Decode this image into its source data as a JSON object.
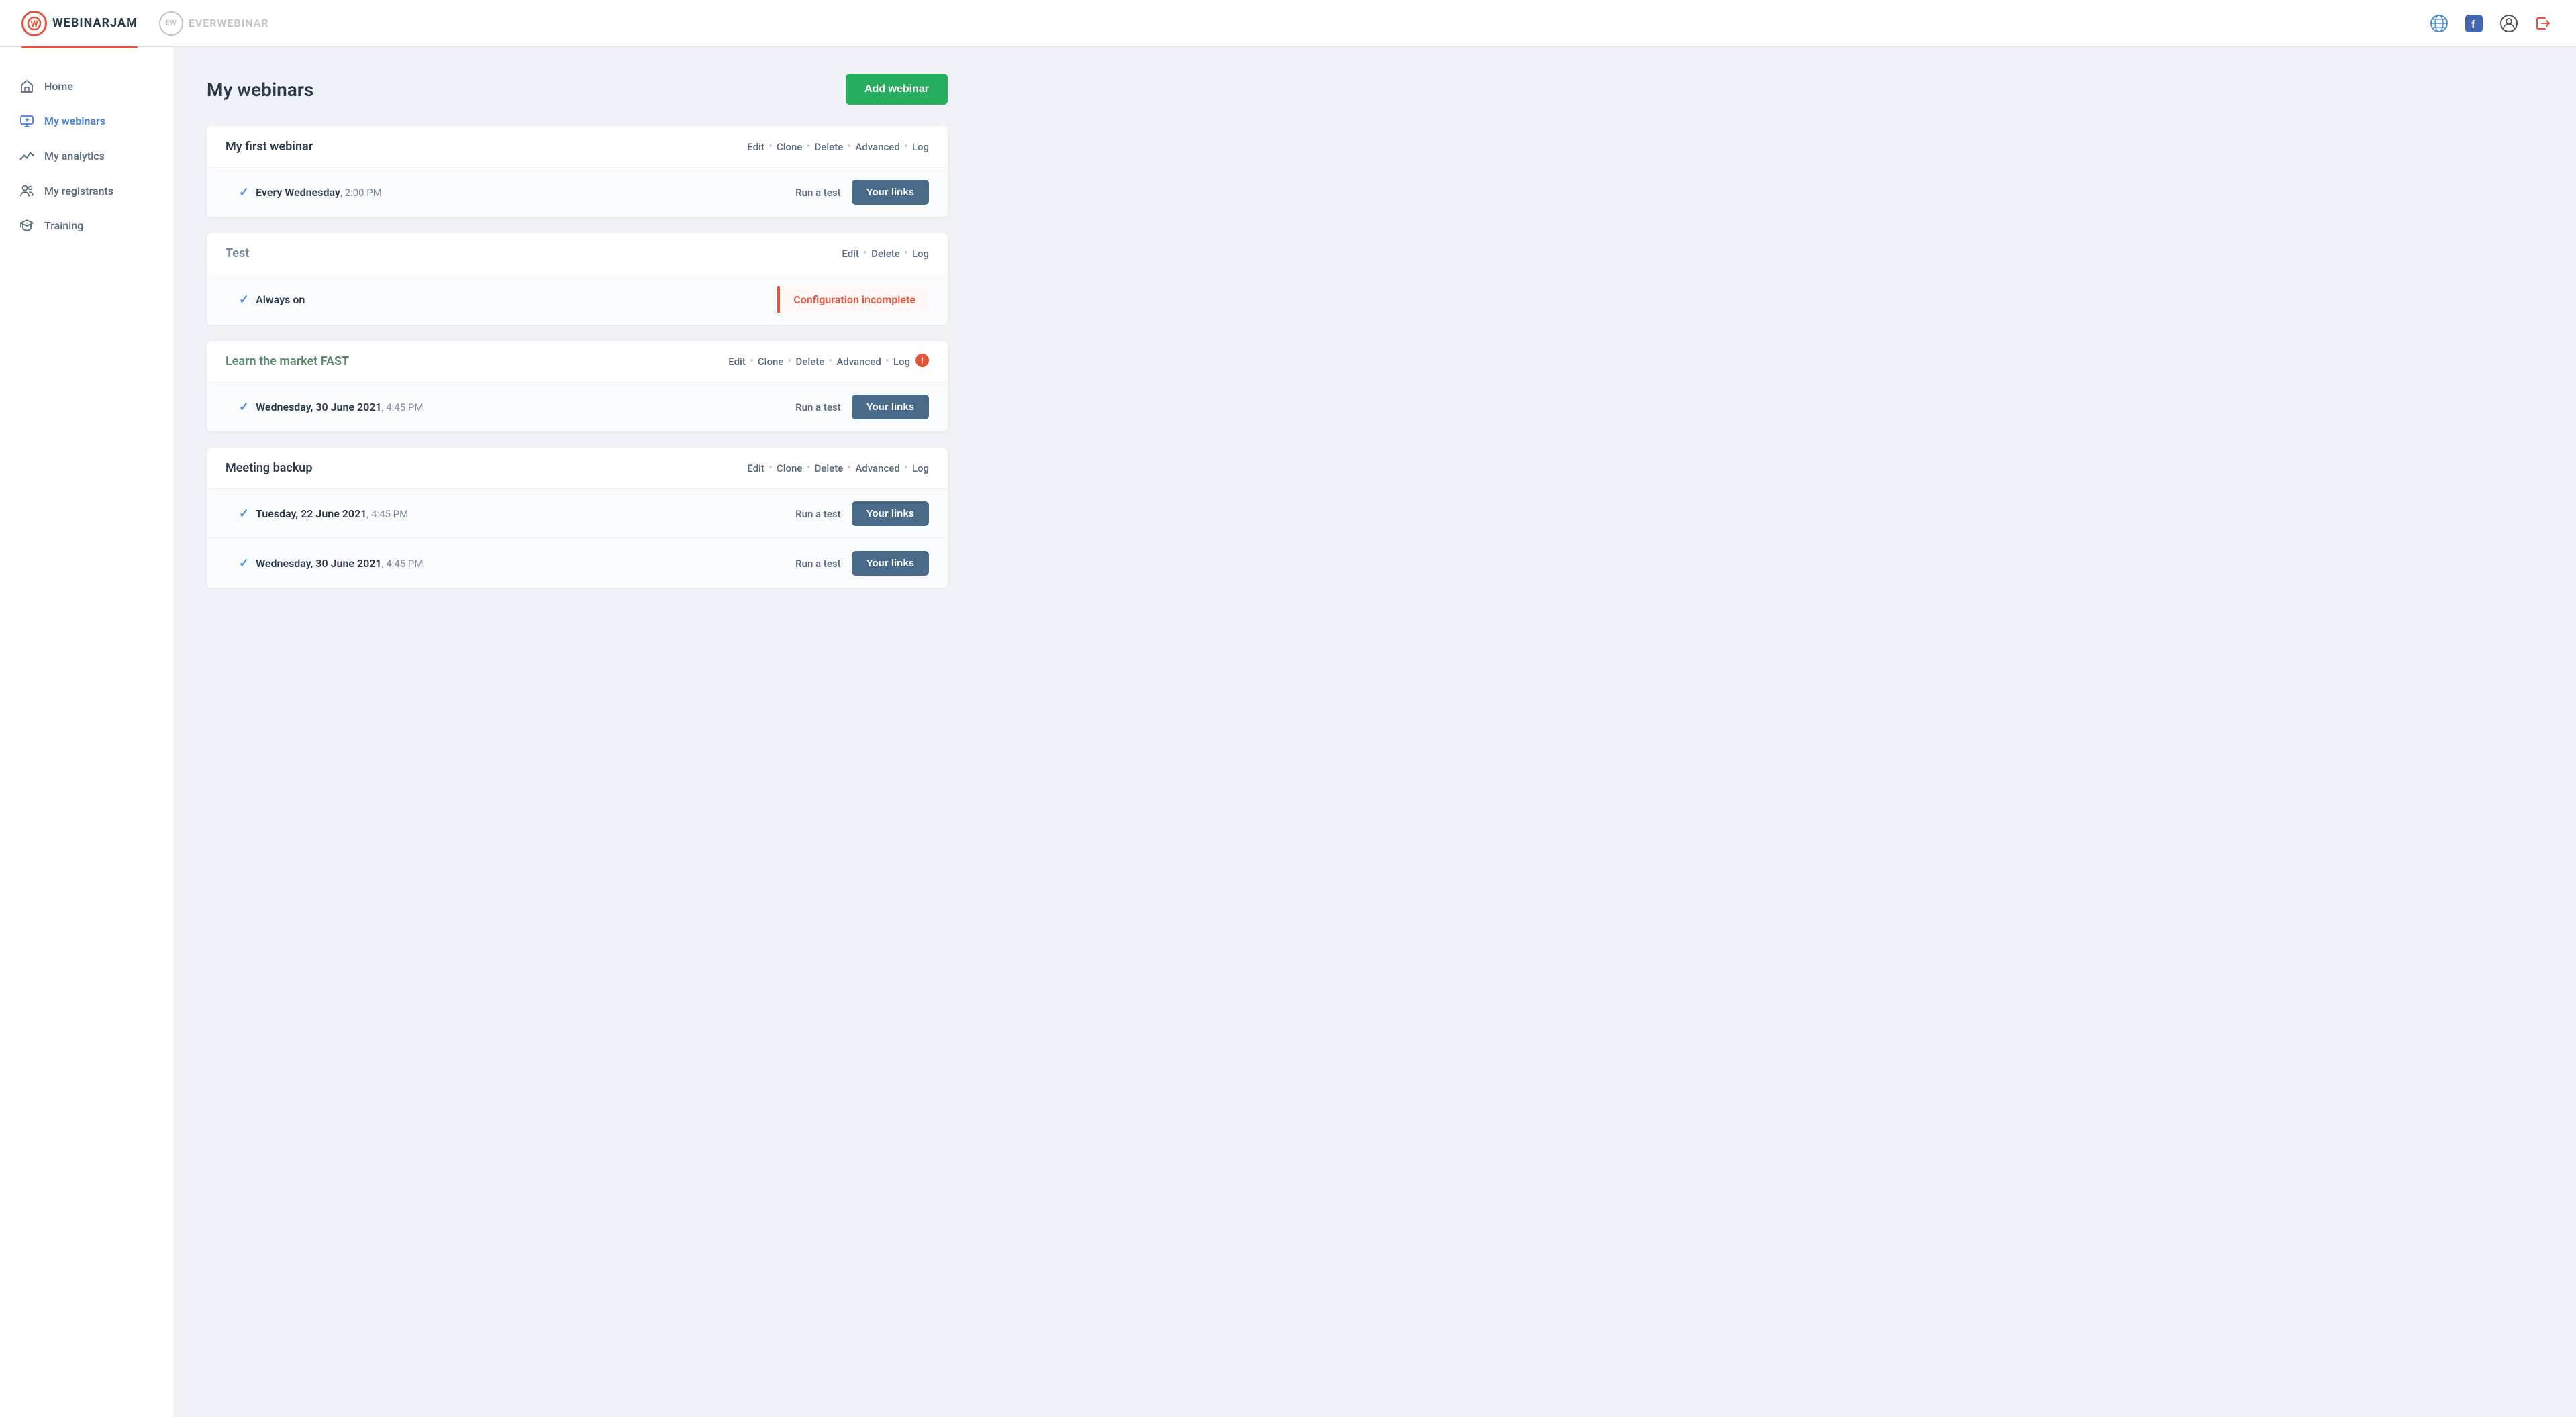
{
  "topnav": {
    "brand_wj": "WEBINARJAM",
    "brand_ew": "EVERWEBINAR",
    "wj_initial": "W",
    "ew_initial": "EW"
  },
  "sidebar": {
    "items": [
      {
        "id": "home",
        "label": "Home",
        "active": false
      },
      {
        "id": "my-webinars",
        "label": "My webinars",
        "active": true
      },
      {
        "id": "my-analytics",
        "label": "My analytics",
        "active": false
      },
      {
        "id": "my-registrants",
        "label": "My registrants",
        "active": false
      },
      {
        "id": "training",
        "label": "Training",
        "active": false
      }
    ]
  },
  "main": {
    "page_title": "My webinars",
    "add_webinar_label": "Add webinar",
    "webinars": [
      {
        "id": "first-webinar",
        "name": "My first webinar",
        "actions": [
          "Edit",
          "Clone",
          "Delete",
          "Advanced",
          "Log"
        ],
        "sessions": [
          {
            "schedule": "Every Wednesday",
            "time": "2:00 PM",
            "run_test": "Run a test",
            "your_links": "Your links"
          }
        ],
        "config_incomplete": false,
        "has_notif": false
      },
      {
        "id": "test",
        "name": "Test",
        "actions": [
          "Edit",
          "Delete",
          "Log"
        ],
        "sessions": [
          {
            "schedule": "Always on",
            "time": "",
            "run_test": "",
            "your_links": "",
            "config_incomplete": true,
            "config_text": "Configuration incomplete"
          }
        ],
        "config_incomplete": true,
        "has_notif": false
      },
      {
        "id": "learn-market-fast",
        "name": "Learn the market FAST",
        "actions": [
          "Edit",
          "Clone",
          "Delete",
          "Advanced",
          "Log"
        ],
        "sessions": [
          {
            "schedule": "Wednesday, 30 June 2021",
            "time": "4:45 PM",
            "run_test": "Run a test",
            "your_links": "Your links"
          }
        ],
        "config_incomplete": false,
        "has_notif": true,
        "notif_count": "!"
      },
      {
        "id": "meeting-backup",
        "name": "Meeting backup",
        "actions": [
          "Edit",
          "Clone",
          "Delete",
          "Advanced",
          "Log"
        ],
        "sessions": [
          {
            "schedule": "Tuesday, 22 June 2021",
            "time": "4:45 PM",
            "run_test": "Run a test",
            "your_links": "Your links"
          },
          {
            "schedule": "Wednesday, 30 June 2021",
            "time": "4:45 PM",
            "run_test": "Run a test",
            "your_links": "Your links"
          }
        ],
        "config_incomplete": false,
        "has_notif": false
      }
    ]
  }
}
